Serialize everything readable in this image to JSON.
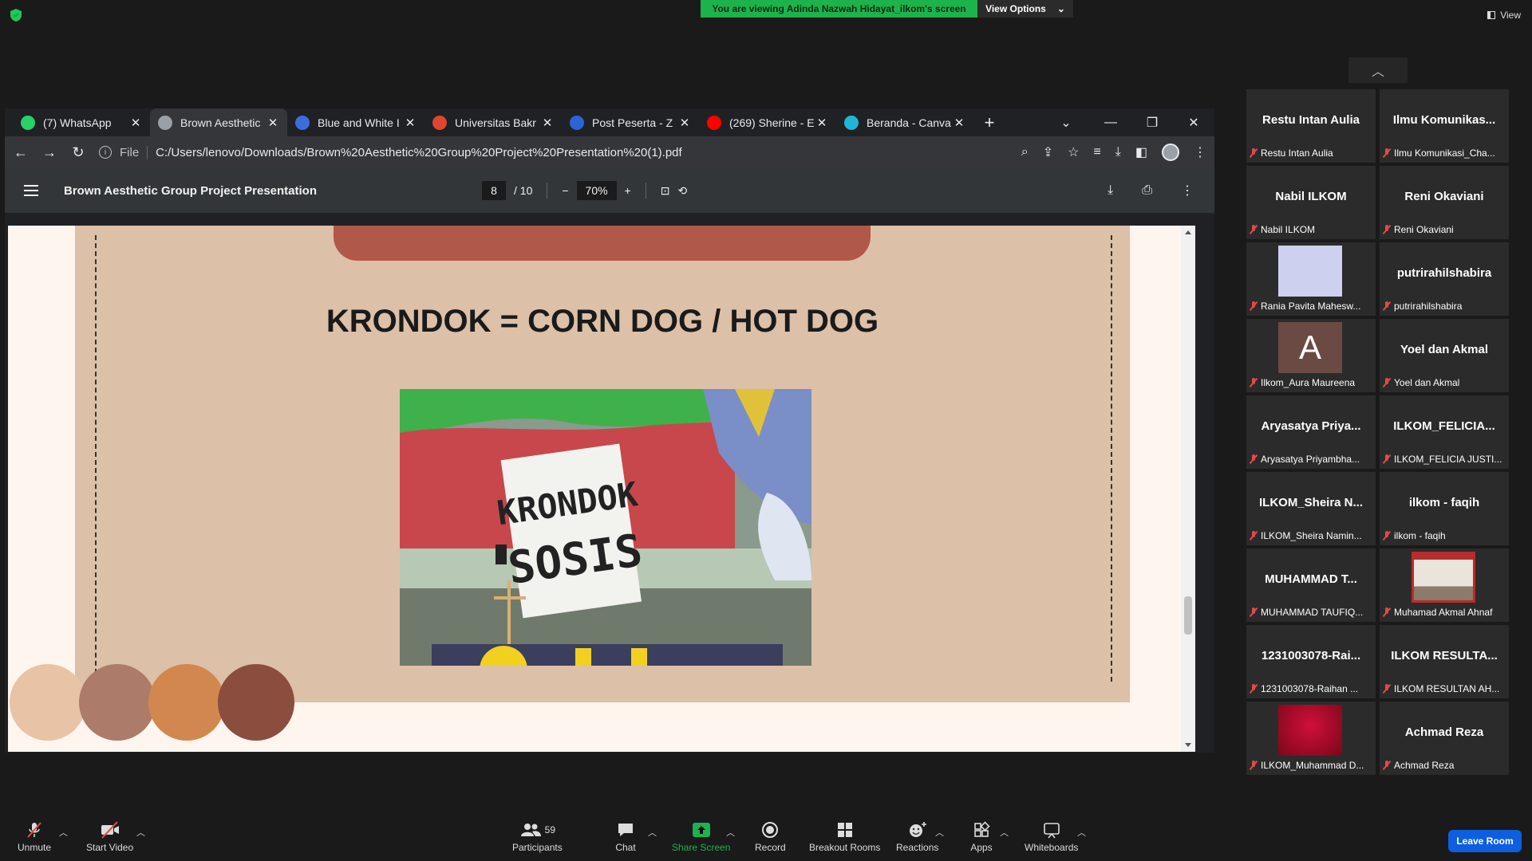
{
  "zoom": {
    "viewing_banner": "You are viewing Adinda Nazwah Hidayat_ilkom's screen",
    "view_options": "View Options",
    "view_label": "View",
    "leave": "Leave Room"
  },
  "browser": {
    "tabs": [
      {
        "title": "(7) WhatsApp",
        "icon": "whatsapp-icon",
        "color": "#25d366"
      },
      {
        "title": "Brown Aesthetic",
        "icon": "globe-icon",
        "color": "#9aa0a6"
      },
      {
        "title": "Blue and White I",
        "icon": "doc-icon",
        "color": "#3b6de0"
      },
      {
        "title": "Universitas Bakr",
        "icon": "b-icon",
        "color": "#e0452f"
      },
      {
        "title": "Post Peserta - Z",
        "icon": "z-icon",
        "color": "#2d63d9"
      },
      {
        "title": "(269) Sherine - E",
        "icon": "youtube-icon",
        "color": "#ff0000"
      },
      {
        "title": "Beranda - Canva",
        "icon": "canva-icon",
        "color": "#1fb6d6"
      }
    ],
    "file_label": "File",
    "url": "C:/Users/lenovo/Downloads/Brown%20Aesthetic%20Group%20Project%20Presentation%20(1).pdf"
  },
  "pdf": {
    "title": "Brown Aesthetic Group Project Presentation",
    "page": "8",
    "total": "/ 10",
    "zoom": "70%"
  },
  "slide": {
    "heading": "KRONDOK = CORN DOG / HOT DOG",
    "sign_line1": "KRONDOK",
    "sign_line2": "SOSIS",
    "palette": [
      "#e8c3a6",
      "#ad7b6a",
      "#d2874f",
      "#8a4d3e"
    ]
  },
  "participants": [
    {
      "big": "Restu Intan Aulia",
      "name": "Restu Intan Aulia"
    },
    {
      "big": "Ilmu  Komunikas...",
      "name": "Ilmu Komunikasi_Cha..."
    },
    {
      "big": "Nabil ILKOM",
      "name": "Nabil ILKOM"
    },
    {
      "big": "Reni Okaviani",
      "name": "Reni Okaviani"
    },
    {
      "big": "",
      "name": "Rania Pavita Mahesw...",
      "image": "lavender"
    },
    {
      "big": "putrirahilshabira",
      "name": "putrirahilshabira"
    },
    {
      "big": "A",
      "name": "Ilkom_Aura Maureena",
      "image": "avatar-a"
    },
    {
      "big": "Yoel dan Akmal",
      "name": "Yoel dan Akmal"
    },
    {
      "big": "Aryasatya  Priya...",
      "name": "Aryasatya Priyambha..."
    },
    {
      "big": "ILKOM_FELICIA...",
      "name": "ILKOM_FELICIA JUSTI..."
    },
    {
      "big": "ILKOM_Sheira  N...",
      "name": "ILKOM_Sheira Namin..."
    },
    {
      "big": "ilkom - faqih",
      "name": "ilkom - faqih"
    },
    {
      "big": "MUHAMMAD  T...",
      "name": "MUHAMMAD TAUFIQ..."
    },
    {
      "big": "",
      "name": "Muhamad Akmal Ahnaf",
      "image": "video"
    },
    {
      "big": "1231003078-Rai...",
      "name": "1231003078-Raihan ..."
    },
    {
      "big": "ILKOM  RESULTA...",
      "name": "ILKOM RESULTAN AH..."
    },
    {
      "big": "",
      "name": "ILKOM_Muhammad D...",
      "image": "red"
    },
    {
      "big": "Achmad Reza",
      "name": "Achmad Reza"
    }
  ],
  "toolbar": {
    "unmute": "Unmute",
    "start_video": "Start Video",
    "participants": "Participants",
    "participants_count": "59",
    "chat": "Chat",
    "share": "Share Screen",
    "record": "Record",
    "breakout": "Breakout Rooms",
    "reactions": "Reactions",
    "apps": "Apps",
    "whiteboards": "Whiteboards"
  }
}
